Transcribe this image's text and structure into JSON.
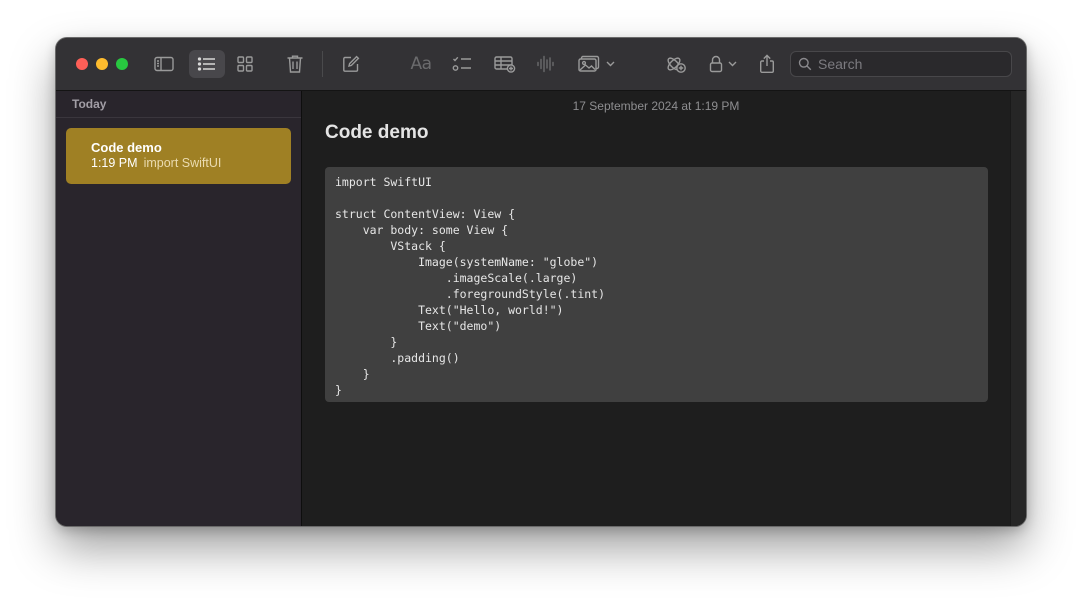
{
  "toolbar": {
    "buttons": [
      {
        "name": "sidebar-toggle",
        "icon": "sidebar-icon"
      },
      {
        "name": "list-view",
        "icon": "list-icon",
        "active": true
      },
      {
        "name": "gallery-view",
        "icon": "grid-icon"
      },
      {
        "name": "delete",
        "icon": "trash-icon"
      },
      {
        "name": "new-note",
        "icon": "compose-icon"
      },
      {
        "name": "format",
        "icon": "text-format-icon",
        "label": "Aa"
      },
      {
        "name": "checklist",
        "icon": "checklist-icon"
      },
      {
        "name": "table",
        "icon": "table-icon"
      },
      {
        "name": "audio",
        "icon": "waveform-icon"
      },
      {
        "name": "media",
        "icon": "photo-icon"
      },
      {
        "name": "collaborate",
        "icon": "collaborate-icon"
      },
      {
        "name": "lock",
        "icon": "lock-icon"
      },
      {
        "name": "share",
        "icon": "share-icon"
      }
    ],
    "search_placeholder": "Search"
  },
  "sidebar": {
    "section_title": "Today",
    "notes": [
      {
        "title": "Code demo",
        "time": "1:19 PM",
        "preview": "import SwiftUI",
        "selected": true
      }
    ]
  },
  "editor": {
    "date": "17 September 2024 at 1:19 PM",
    "title": "Code demo",
    "code": "import SwiftUI\n\nstruct ContentView: View {\n    var body: some View {\n        VStack {\n            Image(systemName: \"globe\")\n                .imageScale(.large)\n                .foregroundStyle(.tint)\n            Text(\"Hello, world!\")\n            Text(\"demo\")\n        }\n        .padding()\n    }\n}"
  },
  "colors": {
    "accent_note_selected": "#9f8024",
    "toolbar_bg": "#333235",
    "sidebar_bg": "#29252c",
    "editor_bg": "#1e1e1e",
    "code_bg": "#404040",
    "traffic_close": "#fe5f57",
    "traffic_minimize": "#febc2e",
    "traffic_zoom": "#28c840"
  }
}
